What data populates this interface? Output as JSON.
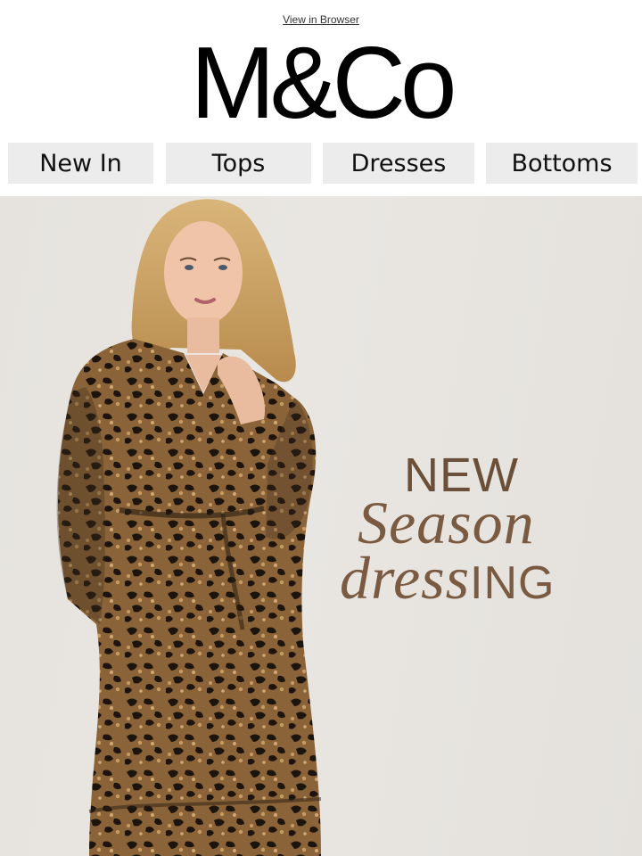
{
  "header": {
    "view_in_browser": "View in Browser",
    "logo_text": "M&Co"
  },
  "nav": {
    "items": [
      {
        "label": "New In"
      },
      {
        "label": "Tops"
      },
      {
        "label": "Dresses"
      },
      {
        "label": "Bottoms"
      }
    ]
  },
  "hero": {
    "headline_line1": "NEW",
    "headline_line2": "Season",
    "headline_line3_a": "dress",
    "headline_line3_b": "ING",
    "text_color": "#6b4f38",
    "background_color": "#e7e4e0",
    "image": "model-in-leopard-print-dress"
  },
  "colors": {
    "nav_background": "#ececec",
    "logo": "#000000"
  }
}
